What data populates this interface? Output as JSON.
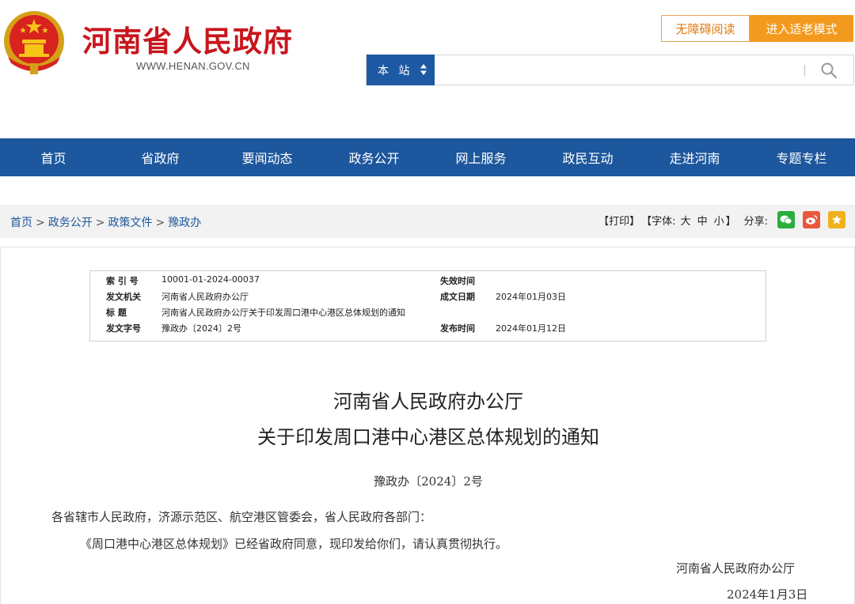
{
  "header": {
    "site_title": "河南省人民政府",
    "site_url": "WWW.HENAN.GOV.CN",
    "accessibility_label": "无障碍阅读",
    "elder_mode_label": "进入适老模式",
    "search_scope": "本 站",
    "search_value": ""
  },
  "nav": {
    "items": [
      {
        "label": "首页"
      },
      {
        "label": "省政府"
      },
      {
        "label": "要闻动态"
      },
      {
        "label": "政务公开"
      },
      {
        "label": "网上服务"
      },
      {
        "label": "政民互动"
      },
      {
        "label": "走进河南"
      },
      {
        "label": "专题专栏"
      }
    ]
  },
  "breadcrumb": {
    "items": [
      "首页",
      "政务公开",
      "政策文件",
      "豫政办"
    ],
    "separator": ">"
  },
  "tools": {
    "print": "【打印】",
    "font_prefix": "【字体:",
    "font_large": "大",
    "font_medium": "中",
    "font_small": "小",
    "font_suffix": "】",
    "share_label": "分享:"
  },
  "info": {
    "index_label": "索 引 号",
    "index_value": "10001-01-2024-00037",
    "expiry_label": "失效时间",
    "expiry_value": "",
    "issuer_label": "发文机关",
    "issuer_value": "河南省人民政府办公厅",
    "written_label": "成文日期",
    "written_value": "2024年01月03日",
    "title_label": "标 题",
    "title_value": "河南省人民政府办公厅关于印发周口港中心港区总体规划的通知",
    "docno_label": "发文字号",
    "docno_value": "豫政办〔2024〕2号",
    "publish_label": "发布时间",
    "publish_value": "2024年01月12日"
  },
  "document": {
    "title_line1": "河南省人民政府办公厅",
    "title_line2": "关于印发周口港中心港区总体规划的通知",
    "doc_number": "豫政办〔2024〕2号",
    "salutation": "各省辖市人民政府，济源示范区、航空港区管委会，省人民政府各部门：",
    "body": "《周口港中心港区总体规划》已经省政府同意，现印发给你们，请认真贯彻执行。",
    "signature": "河南省人民政府办公厅",
    "date": "2024年1月3日"
  },
  "colors": {
    "brand_red": "#c8161d",
    "nav_blue": "#1d579d",
    "elder_orange": "#f39a1e"
  }
}
